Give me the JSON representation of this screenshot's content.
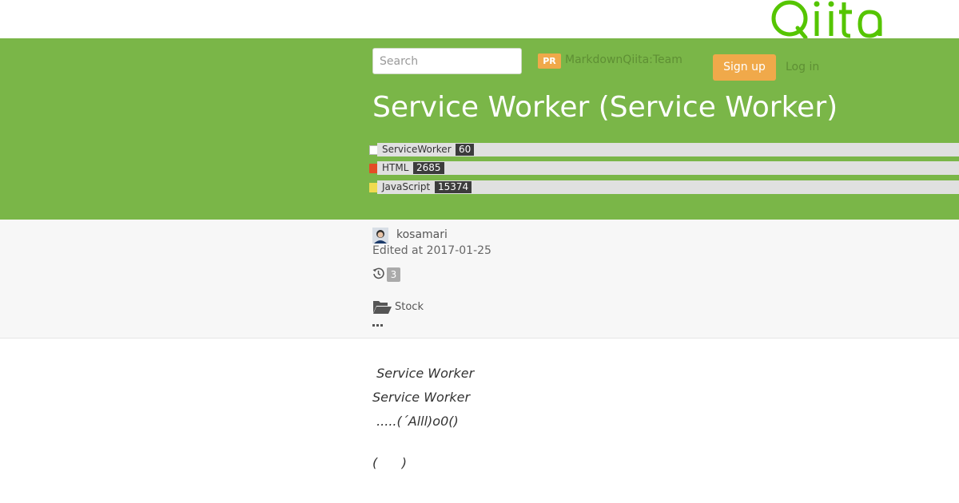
{
  "header": {
    "logo_text": "Qiita",
    "search_placeholder": "Search",
    "pr_badge": "PR",
    "pr_text": "MarkdownQiita:Team",
    "signup_label": "Sign up",
    "login_label": "Log in"
  },
  "article": {
    "title": "Service Worker (Service Worker)",
    "tags": [
      {
        "name": "ServiceWorker",
        "count": "60",
        "icon": "service-worker-icon"
      },
      {
        "name": "HTML",
        "count": "2685",
        "icon": "html5-icon"
      },
      {
        "name": "JavaScript",
        "count": "15374",
        "icon": "javascript-icon"
      }
    ],
    "author": "kosamari",
    "edited": "Edited at 2017-01-25",
    "revisions": "3",
    "stock_label": "Stock",
    "body_lines": [
      " Service Worker",
      "Service Worker",
      " .....(´Alll)o0()",
      "(      )"
    ]
  },
  "colors": {
    "brand_green": "#7ab648",
    "accent_orange": "#f0a94a",
    "tag_count_bg": "#3c3c3c",
    "meta_bg": "#f7f7f7"
  }
}
